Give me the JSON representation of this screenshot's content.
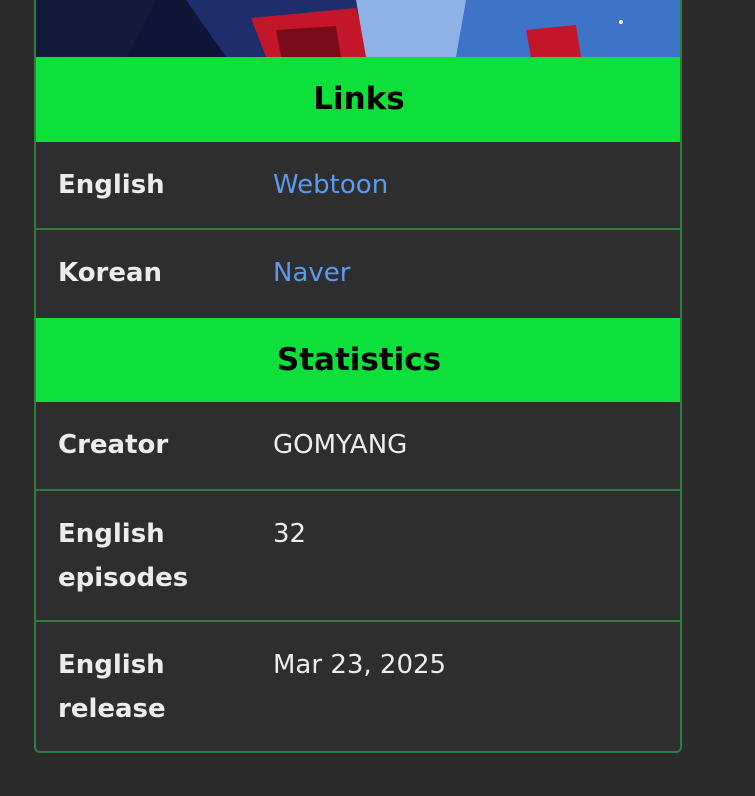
{
  "links": {
    "header": "Links",
    "rows": [
      {
        "label": "English",
        "value": "Webtoon"
      },
      {
        "label": "Korean",
        "value": "Naver"
      }
    ]
  },
  "statistics": {
    "header": "Statistics",
    "rows": [
      {
        "label": "Creator",
        "value": "GOMYANG"
      },
      {
        "label": "English episodes",
        "value": "32"
      },
      {
        "label": "English release",
        "value": "Mar 23, 2025"
      }
    ]
  },
  "colors": {
    "header_bg": "#0ddf3b",
    "border": "#2f7d3a",
    "link": "#5a9bf0",
    "background": "#2e2e2e"
  }
}
